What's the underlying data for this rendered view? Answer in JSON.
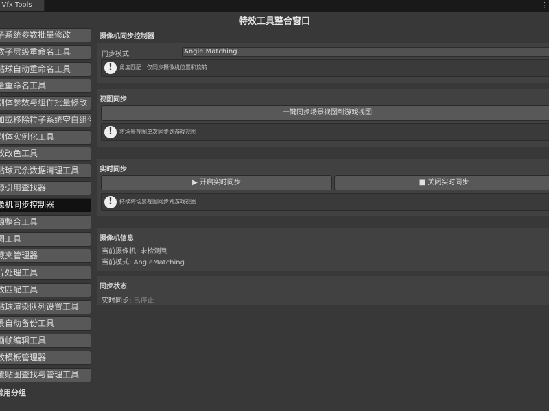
{
  "tab": {
    "title": "Yu Vfx Tools"
  },
  "window": {
    "menu_glyph": "⋮",
    "title": "特效工具整合窗口"
  },
  "sidebar": {
    "items": [
      {
        "label": "子系统参数批量修改"
      },
      {
        "label": "数子层级重命名工具"
      },
      {
        "label": "贴球自动重命名工具"
      },
      {
        "label": "量重命名工具"
      },
      {
        "label": "刚体参数与组件批量修改"
      },
      {
        "label": "加或移除粒子系统空白组件"
      },
      {
        "label": "刚体实例化工具"
      },
      {
        "label": "效改色工具"
      },
      {
        "label": "贴球冗余数据清理工具"
      },
      {
        "label": "源引用查找器"
      },
      {
        "label": "像机同步控制器",
        "active": true
      },
      {
        "label": "源整合工具"
      },
      {
        "label": "图工具"
      },
      {
        "label": "藏夹管理器"
      },
      {
        "label": "片处理工具"
      },
      {
        "label": "效匹配工具"
      },
      {
        "label": "贴球渲染队列设置工具"
      },
      {
        "label": "景自动备份工具"
      },
      {
        "label": "画帧编辑工具"
      },
      {
        "label": "效模板管理器"
      },
      {
        "label": "覆贴图查找与管理工具"
      }
    ],
    "group_label": "常用分组"
  },
  "camera_sync": {
    "header": "摄像机同步控制器",
    "mode_label": "同步模式",
    "mode_value": "Angle Matching",
    "help": "角度匹配：仅同步摄像机位置和旋转"
  },
  "view_sync": {
    "header": "视图同步",
    "button": "一键同步场景视图到游戏视图",
    "help": "将场景视图单次同步到游戏视图"
  },
  "realtime_sync": {
    "header": "实时同步",
    "start_button": "▶ 开启实时同步",
    "stop_button": "■ 关闭实时同步",
    "help": "持续将场景视图同步到游戏视图"
  },
  "camera_info": {
    "header": "摄像机信息",
    "current_camera_label": "当前摄像机:",
    "current_camera_value": "未检测到",
    "current_mode_label": "当前模式:",
    "current_mode_value": "AngleMatching"
  },
  "sync_status": {
    "header": "同步状态",
    "realtime_label": "实时同步:",
    "realtime_value": "已停止"
  },
  "colors": {
    "background": "#383838",
    "panel": "#414141",
    "button": "#585858",
    "active_item": "#111111",
    "tab_bar": "#191919"
  }
}
